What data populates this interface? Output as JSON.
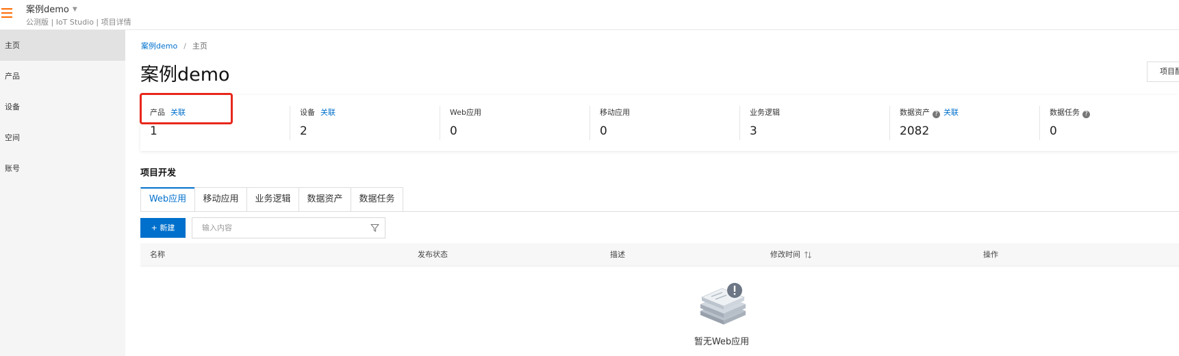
{
  "header": {
    "project_name": "案例demo",
    "subtitle": "公测版 | IoT Studio | 项目详情"
  },
  "sidebar": {
    "items": [
      {
        "label": "主页",
        "active": true
      },
      {
        "label": "产品",
        "active": false
      },
      {
        "label": "设备",
        "active": false
      },
      {
        "label": "空间",
        "active": false
      },
      {
        "label": "账号",
        "active": false
      }
    ]
  },
  "breadcrumb": {
    "project": "案例demo",
    "separator": "/",
    "current": "主页"
  },
  "page": {
    "title": "案例demo",
    "config_button": "项目配置"
  },
  "stats": [
    {
      "label": "产品",
      "link": "关联",
      "value": "1"
    },
    {
      "label": "设备",
      "link": "关联",
      "value": "2"
    },
    {
      "label": "Web应用",
      "value": "0"
    },
    {
      "label": "移动应用",
      "value": "0"
    },
    {
      "label": "业务逻辑",
      "value": "3"
    },
    {
      "label": "数据资产",
      "link": "关联",
      "help": "?",
      "value": "2082"
    },
    {
      "label": "数据任务",
      "help": "?",
      "value": "0"
    }
  ],
  "section": {
    "title": "项目开发"
  },
  "tabs": [
    {
      "label": "Web应用",
      "active": true
    },
    {
      "label": "移动应用",
      "active": false
    },
    {
      "label": "业务逻辑",
      "active": false
    },
    {
      "label": "数据资产",
      "active": false
    },
    {
      "label": "数据任务",
      "active": false
    }
  ],
  "toolbar": {
    "new_label": "+ 新建",
    "search_placeholder": "输入内容"
  },
  "table": {
    "columns": [
      "名称",
      "发布状态",
      "描述",
      "修改时间",
      "操作"
    ]
  },
  "empty": {
    "text": "暂无Web应用"
  },
  "colors": {
    "accent": "#0070cc",
    "brand_orange": "#ff6a00",
    "highlight": "#e8261b"
  }
}
